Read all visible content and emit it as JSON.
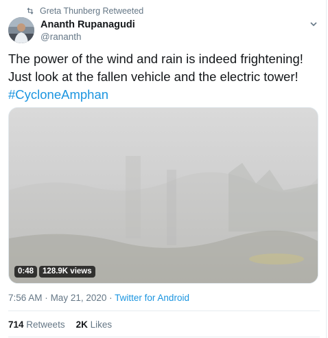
{
  "retweet_context": {
    "label": "Greta Thunberg Retweeted",
    "icon": "retweet-icon"
  },
  "author": {
    "display_name": "Ananth Rupanagudi",
    "handle": "@rananth"
  },
  "menu_icon": "chevron-down-icon",
  "tweet": {
    "text_line1": "The power of the wind and rain is indeed frightening!",
    "text_line2": "Just look at the fallen vehicle and the electric tower!",
    "hashtag": "#CycloneAmphan"
  },
  "video": {
    "duration": "0:48",
    "views": "128.9K views"
  },
  "meta": {
    "time": "7:56 AM",
    "separator": "·",
    "date": "May 21, 2020",
    "source": "Twitter for Android"
  },
  "stats": {
    "retweets_count": "714",
    "retweets_label": "Retweets",
    "likes_count": "2K",
    "likes_label": "Likes"
  },
  "colors": {
    "link": "#1b95e0",
    "secondary_text": "#657786",
    "primary_text": "#14171a",
    "divider": "#e6ecf0"
  }
}
